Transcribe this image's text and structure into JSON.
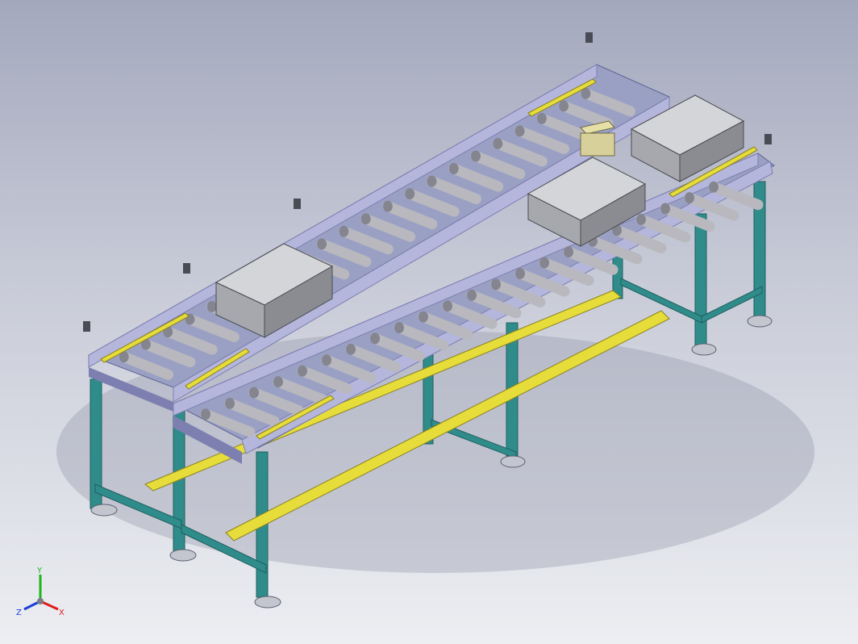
{
  "viewport": {
    "background_top": "#a3a8bd",
    "background_bottom": "#eceef2"
  },
  "model": {
    "description_items": [
      "roller-conveyor-upper",
      "roller-conveyor-lower",
      "storage-boxes",
      "aluminium-frame",
      "photo-sensors",
      "leveling-feet"
    ],
    "colors": {
      "frame_profile": "#2f8c8a",
      "frame_profile_dark": "#1f5f60",
      "side_plate": "#b5b6dc",
      "side_plate_dark": "#7d7fb0",
      "roller": "#b8b8be",
      "roller_dark": "#85858f",
      "yellow_guide": "#e6dc3a",
      "box": "#c8c9cc",
      "box_dark": "#7a7c82",
      "foot": "#c4c6cf"
    }
  },
  "triad": {
    "x_label": "X",
    "y_label": "Y",
    "z_label": "Z",
    "x_color": "#e01b1b",
    "y_color": "#1bb51b",
    "z_color": "#1b3fd6"
  }
}
